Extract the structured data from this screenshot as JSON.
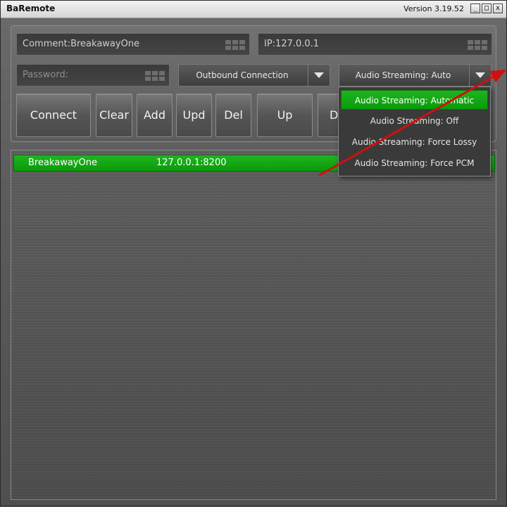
{
  "window": {
    "title": "BaRemote",
    "version": "Version 3.19.52",
    "controls": {
      "minimize": "_",
      "maximize": "□",
      "close": "x"
    }
  },
  "form": {
    "comment_value": "Comment:BreakawayOne",
    "ip_value": "IP:127.0.0.1",
    "password_placeholder": "Password:",
    "connection_mode": "Outbound Connection",
    "audio_mode": "Audio Streaming: Auto"
  },
  "buttons": {
    "connect": "Connect",
    "clear": "Clear",
    "add": "Add",
    "upd": "Upd",
    "del": "Del",
    "up": "Up",
    "down_partial": "D"
  },
  "list": {
    "rows": [
      {
        "name": "BreakawayOne",
        "address": "127.0.0.1:8200"
      }
    ]
  },
  "audio_dropdown": {
    "options": [
      "Audio Streaming: Automatic",
      "Audio Streaming: Off",
      "Audio Streaming: Force Lossy",
      "Audio Streaming: Force PCM"
    ],
    "selected_index": 0
  },
  "colors": {
    "accent_green": "#0fa60f",
    "annotation_arrow": "#d01010"
  },
  "icons": {
    "field_keypad": "keypad-icon",
    "combo_arrow": "chevron-down-icon",
    "annotation": "red-arrow-annotation"
  }
}
